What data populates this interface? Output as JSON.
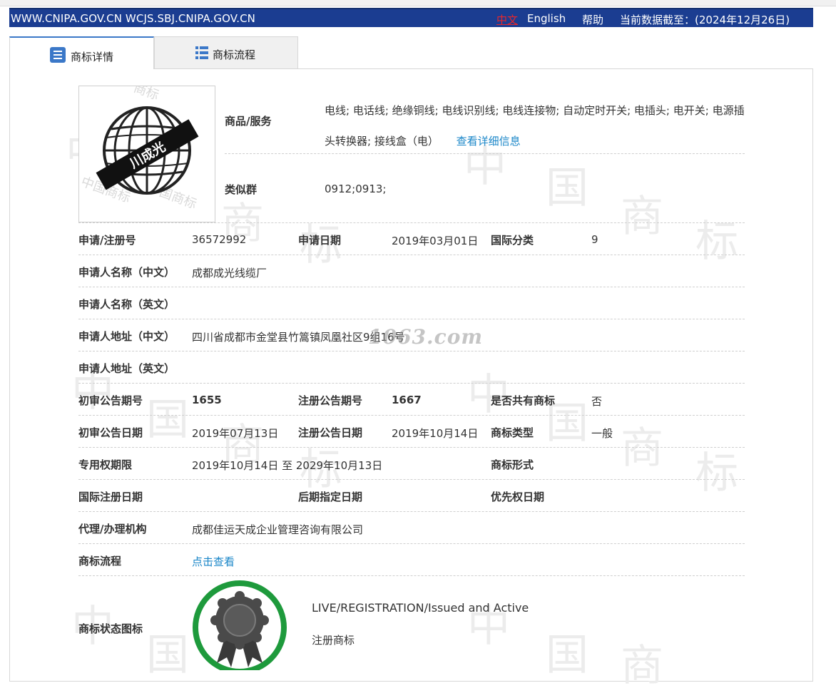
{
  "header": {
    "site": "WWW.CNIPA.GOV.CN WCJS.SBJ.CNIPA.GOV.CN",
    "lang_zh": "中文",
    "lang_en": "English",
    "help": "帮助",
    "as_of": "当前数据截至：(2024年12月26日)"
  },
  "tabs": [
    {
      "label": "商标详情",
      "icon": "list-icon",
      "active": true
    },
    {
      "label": "商标流程",
      "icon": "grid-list-icon",
      "active": false
    }
  ],
  "mark_image": {
    "text": "川成光"
  },
  "goods": {
    "label": "商品/服务",
    "value": "电线; 电话线; 绝缘铜线; 电线识别线; 电线连接物; 自动定时开关; 电插头; 电开关; 电源插头转换器; 接线盒（电）",
    "detail_link": "查看详细信息"
  },
  "similar_group": {
    "label": "类似群",
    "value": "0912;0913;"
  },
  "fields": {
    "app_no_label": "申请/注册号",
    "app_no": "36572992",
    "app_date_label": "申请日期",
    "app_date": "2019年03月01日",
    "intl_class_label": "国际分类",
    "intl_class": "9",
    "applicant_cn_label": "申请人名称（中文）",
    "applicant_cn": "成都成光线缆厂",
    "applicant_en_label": "申请人名称（英文）",
    "applicant_en": "",
    "address_cn_label": "申请人地址（中文）",
    "address_cn": "四川省成都市金堂县竹篙镇凤凰社区9组16号",
    "address_en_label": "申请人地址（英文）",
    "address_en": "",
    "prelim_no_label": "初审公告期号",
    "prelim_no": "1655",
    "reg_no_label": "注册公告期号",
    "reg_no": "1667",
    "shared_label": "是否共有商标",
    "shared": "否",
    "prelim_date_label": "初审公告日期",
    "prelim_date": "2019年07月13日",
    "reg_date_label": "注册公告日期",
    "reg_date": "2019年10月14日",
    "type_label": "商标类型",
    "type": "一般",
    "term_label": "专用权期限",
    "term": "2019年10月14日 至 2029年10月13日",
    "form_label": "商标形式",
    "form": "",
    "intl_reg_date_label": "国际注册日期",
    "intl_reg_date": "",
    "later_date_label": "后期指定日期",
    "later_date": "",
    "priority_label": "优先权日期",
    "priority": "",
    "agent_label": "代理/办理机构",
    "agent": "成都佳运天成企业管理咨询有限公司",
    "flow_label": "商标流程",
    "flow_link": "点击查看",
    "status_label": "商标状态图标",
    "status_en": "LIVE/REGISTRATION/Issued and Active",
    "status_cn": "注册商标"
  },
  "watermark": {
    "text": "1063.com",
    "bg_chars": [
      "中",
      "国",
      "商",
      "标"
    ]
  },
  "colors": {
    "header_bg": "#1b3d91",
    "link": "#1a86c8",
    "lang_active": "#e8272b",
    "status_ring": "#1e9a3c",
    "tab_active_top": "#3b78c8"
  }
}
